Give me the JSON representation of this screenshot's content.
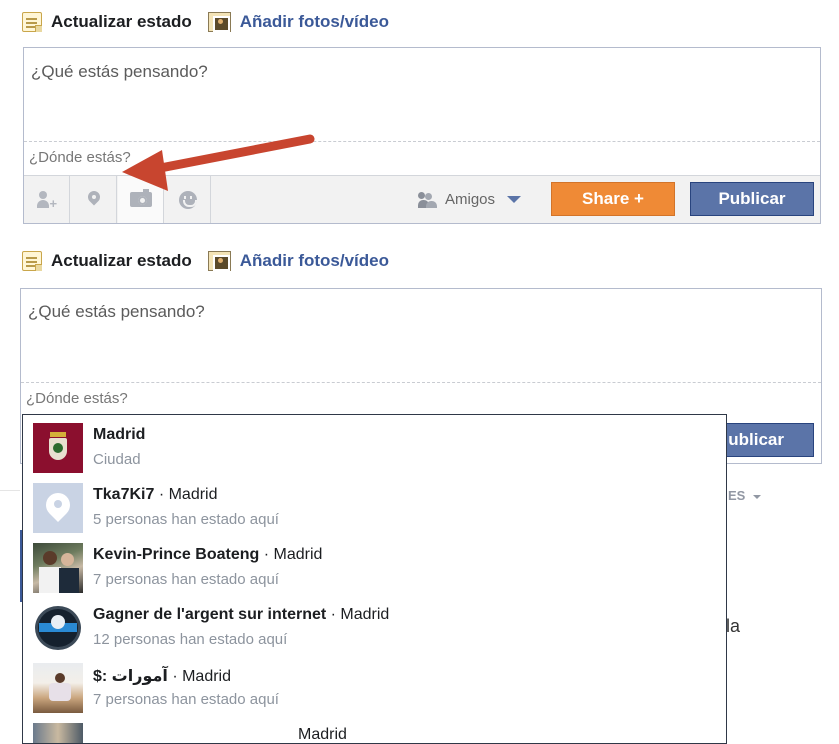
{
  "composer1": {
    "tab_status": "Actualizar estado",
    "tab_photo": "Añadir fotos/vídeo",
    "placeholder": "¿Qué estás pensando?",
    "location_prompt": "¿Dónde estás?",
    "audience": "Amigos",
    "share_button": "Share +",
    "publish_button": "Publicar"
  },
  "composer2": {
    "tab_status": "Actualizar estado",
    "tab_photo": "Añadir fotos/vídeo",
    "placeholder": "¿Qué estás pensando?",
    "location_input_placeholder": "¿Dónde estás?",
    "publish_button_visible": "ublicar"
  },
  "background": {
    "fragment_label": "ES",
    "fragment_text": "la"
  },
  "suggestions": [
    {
      "name": "Madrid",
      "location": "",
      "sub": "Ciudad"
    },
    {
      "name": "Tka7Ki7",
      "location": " · Madrid",
      "sub": "5 personas han estado aquí"
    },
    {
      "name": "Kevin-Prince Boateng",
      "location": " · Madrid",
      "sub": "7 personas han estado aquí"
    },
    {
      "name": "Gagner de l'argent sur internet",
      "location": " · Madrid",
      "sub": "12 personas han estado aquí"
    },
    {
      "name": "$: آمورات",
      "location": " · Madrid",
      "sub": "7 personas han estado aquí"
    },
    {
      "name": "",
      "location": "Madrid",
      "sub": ""
    }
  ],
  "colors": {
    "link": "#3b5998",
    "publish_bg": "#5b74a8",
    "share_bg": "#ef8a36",
    "annotation_arrow": "#c8452f"
  },
  "icons": {
    "tag_friends": "person-plus-icon",
    "location": "location-pin-icon",
    "camera": "camera-icon",
    "feeling": "smiley-icon",
    "audience": "friends-icon",
    "audience_caret": "chevron-down-icon"
  }
}
